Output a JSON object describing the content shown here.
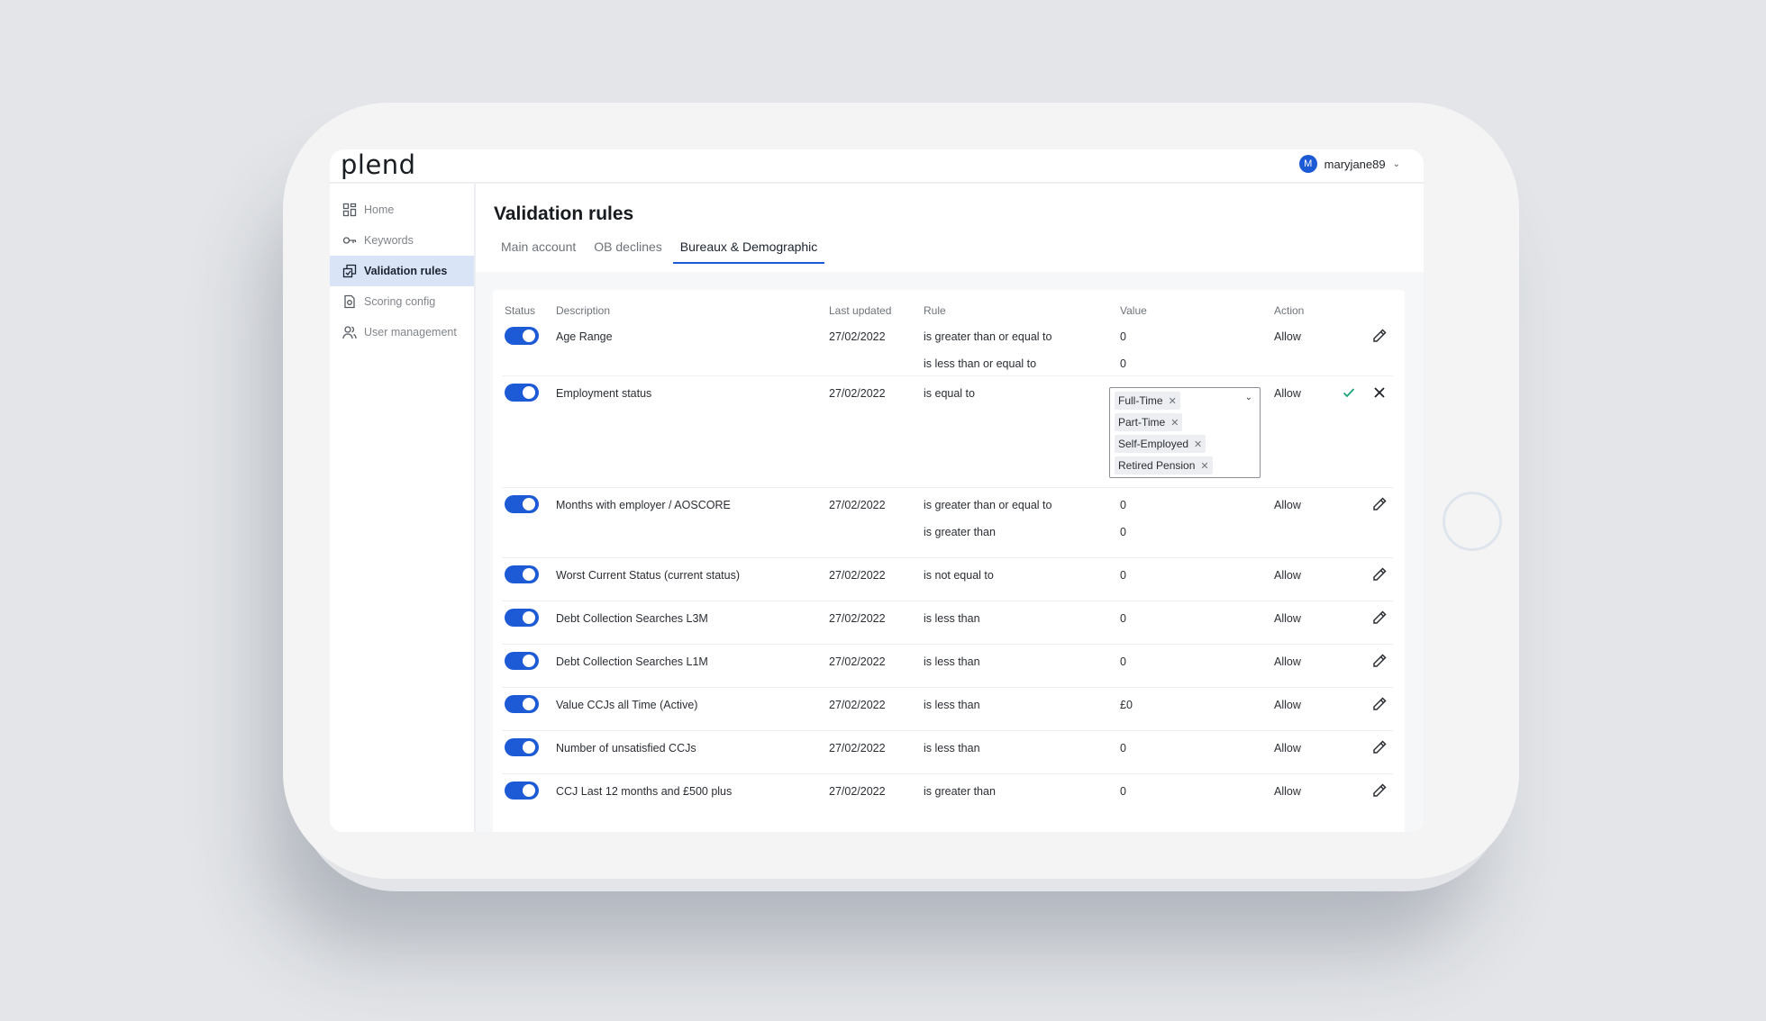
{
  "app": {
    "logo": "plend"
  },
  "user": {
    "avatar_initial": "M",
    "username": "maryjane89"
  },
  "sidebar": {
    "items": [
      {
        "label": "Home",
        "icon": "grid-icon"
      },
      {
        "label": "Keywords",
        "icon": "key-icon"
      },
      {
        "label": "Validation rules",
        "icon": "rules-icon",
        "active": true
      },
      {
        "label": "Scoring config",
        "icon": "document-icon"
      },
      {
        "label": "User management",
        "icon": "users-icon"
      }
    ]
  },
  "page": {
    "title": "Validation rules",
    "tabs": [
      {
        "label": "Main account"
      },
      {
        "label": "OB declines"
      },
      {
        "label": "Bureaux & Demographic",
        "active": true
      }
    ]
  },
  "table": {
    "headers": {
      "status": "Status",
      "description": "Description",
      "last_updated": "Last updated",
      "rule": "Rule",
      "value": "Value",
      "action": "Action"
    },
    "rows": [
      {
        "description": "Age Range",
        "date": "27/02/2022",
        "rule": "is greater than or equal to",
        "rule2": "is less than or equal to",
        "value": "0",
        "value2": "0",
        "action": "Allow",
        "enabled": true
      },
      {
        "description": "Employment status",
        "date": "27/02/2022",
        "rule": "is equal to",
        "action": "Allow",
        "enabled": true,
        "editing": true,
        "selected_values": [
          "Full-Time",
          "Part-Time",
          "Self-Employed",
          "Retired Pension"
        ]
      },
      {
        "description": "Months with employer / AOSCORE",
        "date": "27/02/2022",
        "rule": "is greater than or equal to",
        "rule2": "is greater than",
        "value": "0",
        "value2": "0",
        "action": "Allow",
        "enabled": true
      },
      {
        "description": "Worst Current Status (current status)",
        "date": "27/02/2022",
        "rule": "is not equal to",
        "value": "0",
        "action": "Allow",
        "enabled": true
      },
      {
        "description": "Debt Collection Searches L3M",
        "date": "27/02/2022",
        "rule": "is less than",
        "value": "0",
        "action": "Allow",
        "enabled": true
      },
      {
        "description": "Debt Collection Searches L1M",
        "date": "27/02/2022",
        "rule": "is less than",
        "value": "0",
        "action": "Allow",
        "enabled": true
      },
      {
        "description": "Value CCJs all Time (Active)",
        "date": "27/02/2022",
        "rule": "is less than",
        "value": "£0",
        "action": "Allow",
        "enabled": true
      },
      {
        "description": "Number of unsatisfied CCJs",
        "date": "27/02/2022",
        "rule": "is less than",
        "value": "0",
        "action": "Allow",
        "enabled": true
      },
      {
        "description": "CCJ Last 12 months and £500 plus",
        "date": "27/02/2022",
        "rule": "is greater than",
        "value": "0",
        "action": "Allow",
        "enabled": true
      }
    ]
  },
  "colors": {
    "accent": "#1d5ad6",
    "active_nav_bg": "#d9e4f6",
    "confirm": "#1aa37a"
  }
}
